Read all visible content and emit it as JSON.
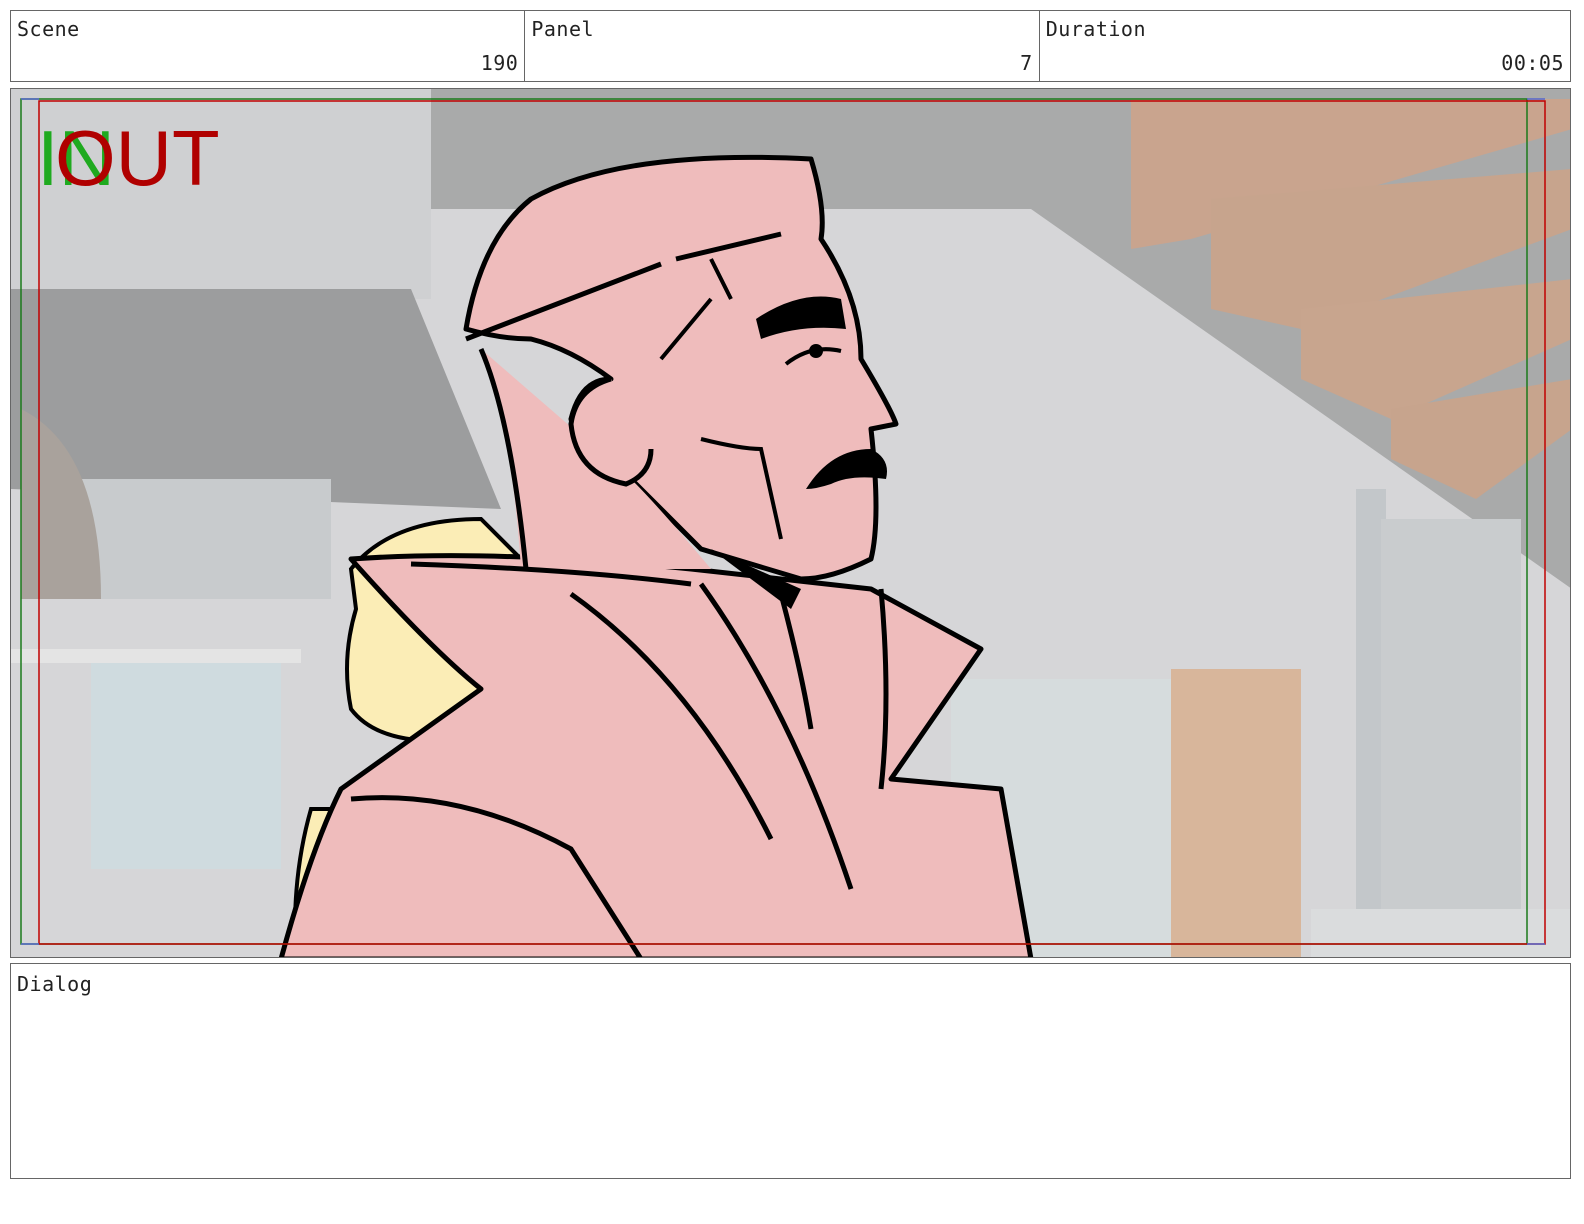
{
  "header": {
    "scene": {
      "label": "Scene",
      "value": "190"
    },
    "panel": {
      "label": "Panel",
      "value": "7"
    },
    "duration": {
      "label": "Duration",
      "value": "00:05"
    }
  },
  "frame": {
    "in_marker": "IN",
    "out_marker": "OUT",
    "colors": {
      "in_marker": "#1faa1f",
      "out_marker": "#b00000",
      "safe_frame": "#c00000",
      "action_frame": "#1a7a1a",
      "skin": "#efbcbc",
      "hair": "#fbedb6",
      "ink": "#000000"
    },
    "image_description_icon": "storyboard-sketch"
  },
  "dialog": {
    "label": "Dialog",
    "text": ""
  }
}
